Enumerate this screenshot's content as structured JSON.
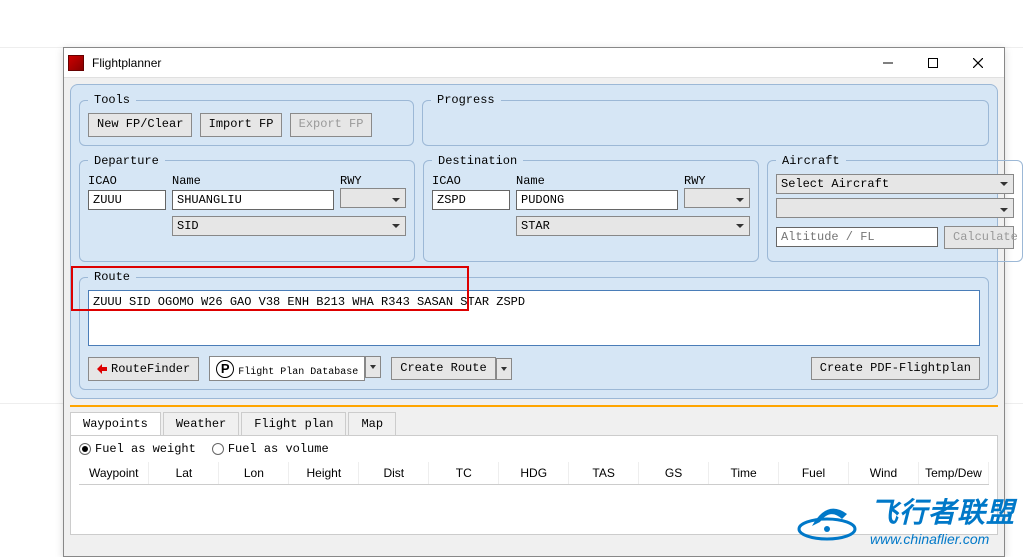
{
  "window": {
    "title": "Flightplanner"
  },
  "tools": {
    "legend": "Tools",
    "new_label": "New FP/Clear",
    "import_label": "Import FP",
    "export_label": "Export FP"
  },
  "progress": {
    "legend": "Progress"
  },
  "departure": {
    "legend": "Departure",
    "icao_label": "ICAO",
    "name_label": "Name",
    "rwy_label": "RWY",
    "icao_value": "ZUUU",
    "name_value": "SHUANGLIU",
    "rwy_value": "",
    "sid_value": "SID"
  },
  "destination": {
    "legend": "Destination",
    "icao_label": "ICAO",
    "name_label": "Name",
    "rwy_label": "RWY",
    "icao_value": "ZSPD",
    "name_value": "PUDONG",
    "rwy_value": "",
    "star_value": "STAR"
  },
  "aircraft": {
    "legend": "Aircraft",
    "select_value": "Select Aircraft",
    "sub_value": "",
    "altitude_placeholder": "Altitude / FL",
    "calculate_label": "Calculate"
  },
  "route": {
    "legend": "Route",
    "text": "ZUUU SID OGOMO W26 GAO V38 ENH B213 WHA R343 SASAN STAR ZSPD",
    "routefinder_label": "RouteFinder",
    "db_main": "Flight Plan Database",
    "create_route_label": "Create Route",
    "create_pdf_label": "Create PDF-Flightplan"
  },
  "tabs": {
    "items": [
      {
        "label": "Waypoints"
      },
      {
        "label": "Weather"
      },
      {
        "label": "Flight plan"
      },
      {
        "label": "Map"
      }
    ],
    "fuel_weight_label": "Fuel as weight",
    "fuel_volume_label": "Fuel as volume",
    "columns": [
      "Waypoint",
      "Lat",
      "Lon",
      "Height",
      "Dist",
      "TC",
      "HDG",
      "TAS",
      "GS",
      "Time",
      "Fuel",
      "Wind",
      "Temp/Dew"
    ]
  },
  "watermark": {
    "cn": "飞行者联盟",
    "url": "www.chinaflier.com"
  },
  "chart_data": null
}
